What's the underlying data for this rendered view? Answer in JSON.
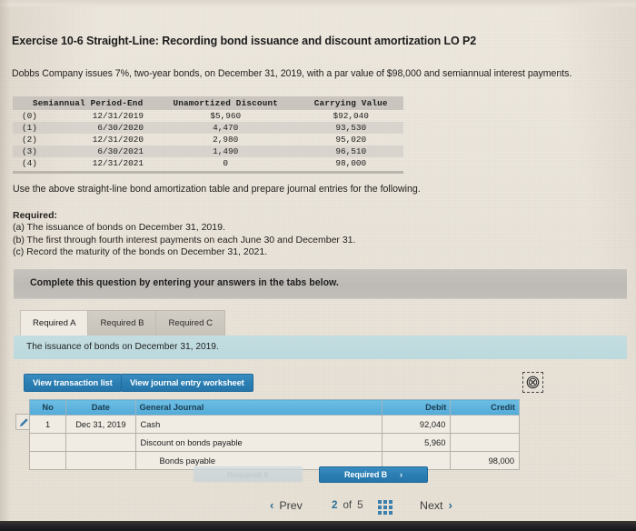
{
  "exercise": {
    "title": "Exercise 10-6 Straight-Line: Recording bond issuance and discount amortization LO P2",
    "intro": "Dobbs Company issues 7%, two-year bonds, on December 31, 2019, with a par value of $98,000 and semiannual interest payments."
  },
  "amortization_table": {
    "headers": [
      "Semiannual Period-End",
      "Unamortized Discount",
      "Carrying Value"
    ],
    "rows": [
      {
        "index": "(0)",
        "date": "12/31/2019",
        "discount": "$5,960",
        "carrying": "$92,040"
      },
      {
        "index": "(1)",
        "date": "6/30/2020",
        "discount": "4,470",
        "carrying": "93,530"
      },
      {
        "index": "(2)",
        "date": "12/31/2020",
        "discount": "2,980",
        "carrying": "95,020"
      },
      {
        "index": "(3)",
        "date": "6/30/2021",
        "discount": "1,490",
        "carrying": "96,510"
      },
      {
        "index": "(4)",
        "date": "12/31/2021",
        "discount": "0",
        "carrying": "98,000"
      }
    ]
  },
  "use_above": "Use the above straight-line bond amortization table and prepare journal entries for the following.",
  "required": {
    "heading": "Required:",
    "items": [
      "(a) The issuance of bonds on December 31, 2019.",
      "(b) The first through fourth interest payments on each June 30 and December 31.",
      "(c) Record the maturity of the bonds on December 31, 2021."
    ]
  },
  "banner": {
    "text": "Complete this question by entering your answers in the tabs below."
  },
  "tabs": [
    {
      "label": "Required A",
      "active": true
    },
    {
      "label": "Required B",
      "active": false
    },
    {
      "label": "Required C",
      "active": false
    }
  ],
  "instruction_strip": {
    "text": "The issuance of bonds on December 31, 2019."
  },
  "toolbar": {
    "view_transaction_list": "View transaction list",
    "view_journal_entry_worksheet": "View journal entry worksheet"
  },
  "journal": {
    "headers": [
      "No",
      "Date",
      "General Journal",
      "Debit",
      "Credit"
    ],
    "rows": [
      {
        "no": "1",
        "date": "Dec 31, 2019",
        "account": "Cash",
        "debit": "92,040",
        "credit": "",
        "indent": false
      },
      {
        "no": "",
        "date": "",
        "account": "Discount on bonds payable",
        "debit": "5,960",
        "credit": "",
        "indent": false
      },
      {
        "no": "",
        "date": "",
        "account": "Bonds payable",
        "debit": "",
        "credit": "98,000",
        "indent": true
      }
    ]
  },
  "nav_buttons": {
    "prev_required": "Required A",
    "next_required": "Required B",
    "chevron_left": "‹",
    "chevron_right": "›"
  },
  "bottom_nav": {
    "prev": "Prev",
    "next": "Next",
    "page_current": "2",
    "page_of": "of",
    "page_total": "5",
    "grid_icon": "grid-icon"
  },
  "icons": {
    "edit_pencil": "pencil-icon",
    "broken_image": "broken-image-icon"
  },
  "colors": {
    "accent_blue": "#2a7db2",
    "table_header_blue": "#53abd8",
    "strip_blue": "#c0dbdf",
    "banner_gray": "#c2beb9",
    "page_bg": "#eae4d9"
  }
}
